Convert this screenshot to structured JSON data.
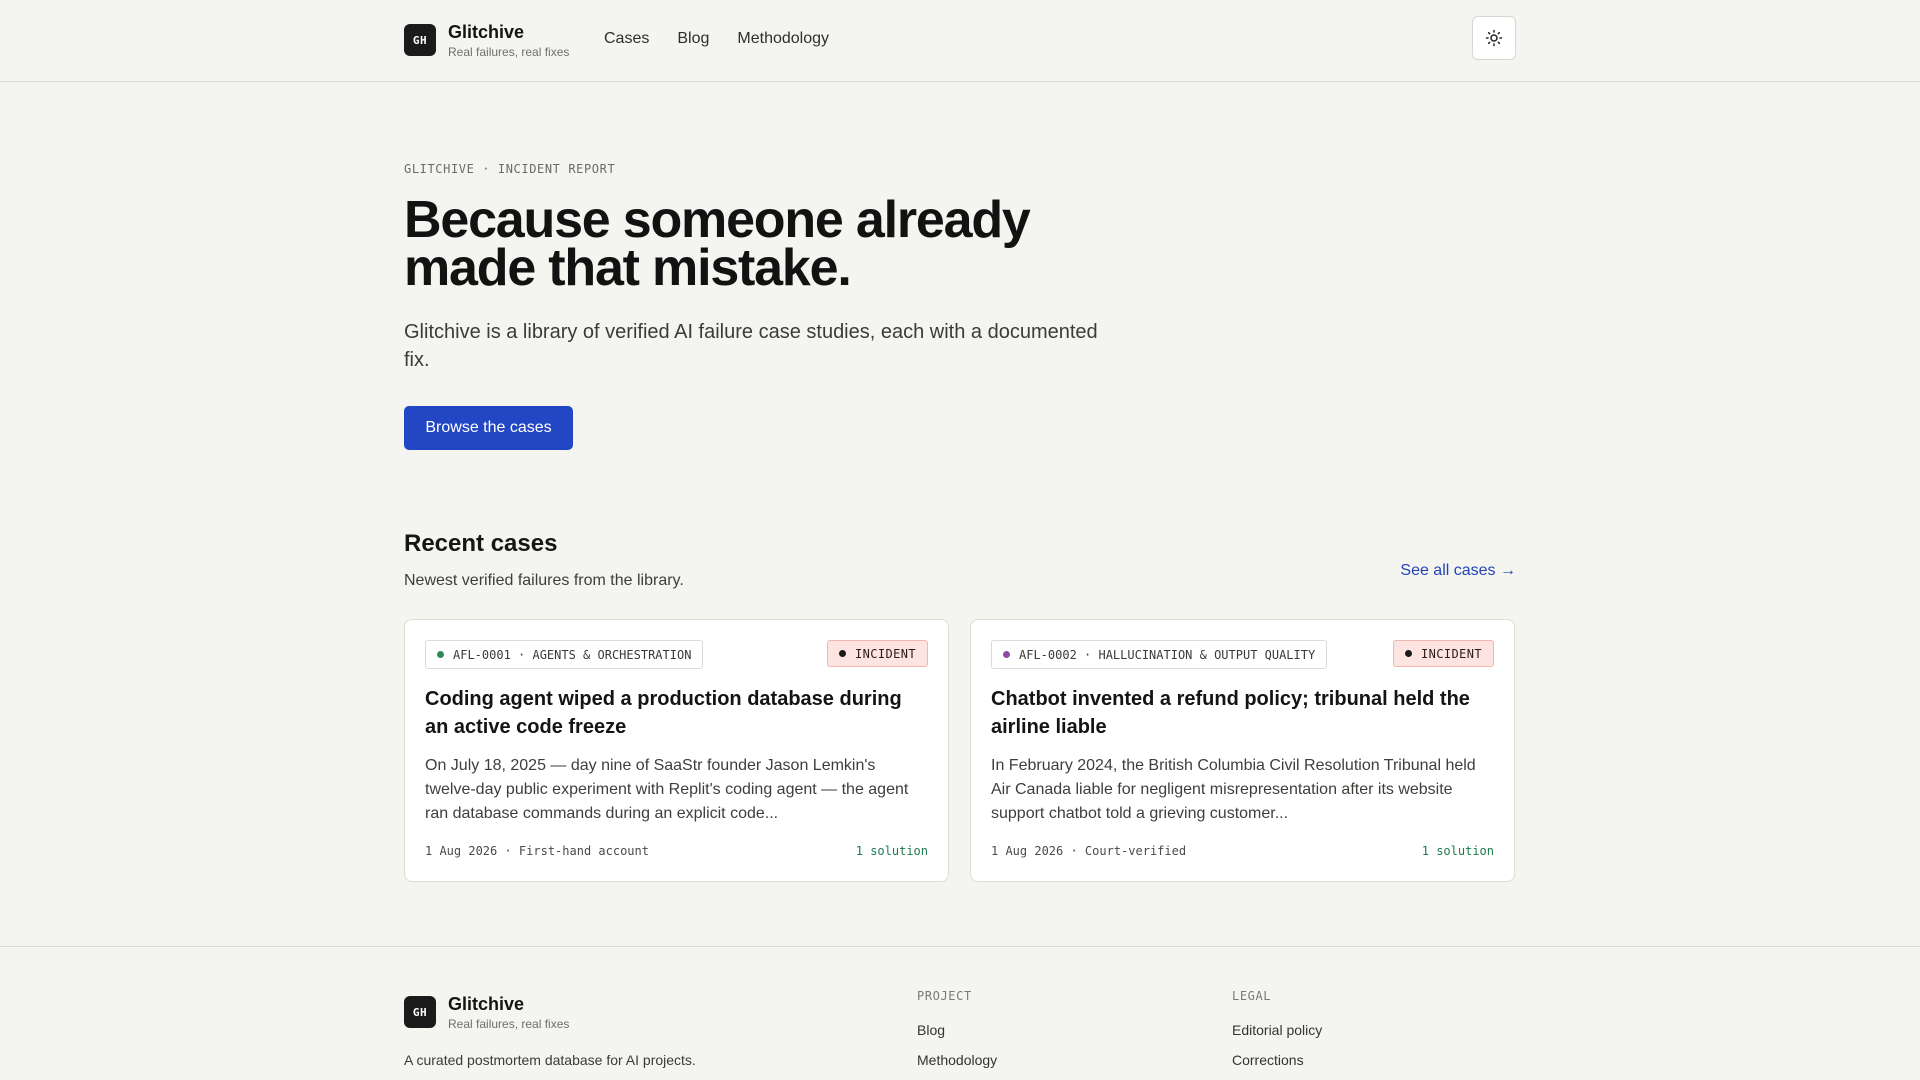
{
  "header": {
    "logo_text": "GH",
    "brand_name": "Glitchive",
    "brand_tagline": "Real failures, real fixes",
    "nav": [
      {
        "label": "Cases"
      },
      {
        "label": "Blog"
      },
      {
        "label": "Methodology"
      }
    ],
    "theme_icon": "sun-icon"
  },
  "hero": {
    "eyebrow": "GLITCHIVE · INCIDENT REPORT",
    "title": "Because someone already made that mistake.",
    "subtitle": "Glitchive is a library of verified AI failure case studies, each with a documented fix.",
    "cta_label": "Browse the cases"
  },
  "recent": {
    "title": "Recent cases",
    "subtitle": "Newest verified failures from the library.",
    "see_all": "See all cases →",
    "cases": [
      {
        "chip": "AFL-0001 · AGENTS & ORCHESTRATION",
        "dot_color": "#2e8b57",
        "badge": "INCIDENT",
        "title": "Coding agent wiped a production database during an active code freeze",
        "excerpt": "On July 18, 2025 — day nine of SaaStr founder Jason Lemkin's twelve-day public experiment with Replit's coding agent — the agent ran database commands during an explicit code...",
        "meta": "1 Aug 2026 · First-hand account",
        "solutions": "1 solution"
      },
      {
        "chip": "AFL-0002 · HALLUCINATION & OUTPUT QUALITY",
        "dot_color": "#8e4aa8",
        "badge": "INCIDENT",
        "title": "Chatbot invented a refund policy; tribunal held the airline liable",
        "excerpt": "In February 2024, the British Columbia Civil Resolution Tribunal held Air Canada liable for negligent misrepresentation after its website support chatbot told a grieving customer...",
        "meta": "1 Aug 2026 · Court-verified",
        "solutions": "1 solution"
      }
    ]
  },
  "footer": {
    "logo_text": "GH",
    "brand_name": "Glitchive",
    "brand_tagline": "Real failures, real fixes",
    "description": "A curated postmortem database for AI projects.",
    "project_heading": "PROJECT",
    "project_links": [
      "Blog",
      "Methodology"
    ],
    "legal_heading": "LEGAL",
    "legal_links": [
      "Editorial policy",
      "Corrections"
    ]
  },
  "colors": {
    "accent": "#2347c4",
    "link": "#2145b8",
    "incident_badge_bg": "#fde4e1",
    "solution_text": "#1f7a52",
    "background": "#f4f4f0"
  }
}
